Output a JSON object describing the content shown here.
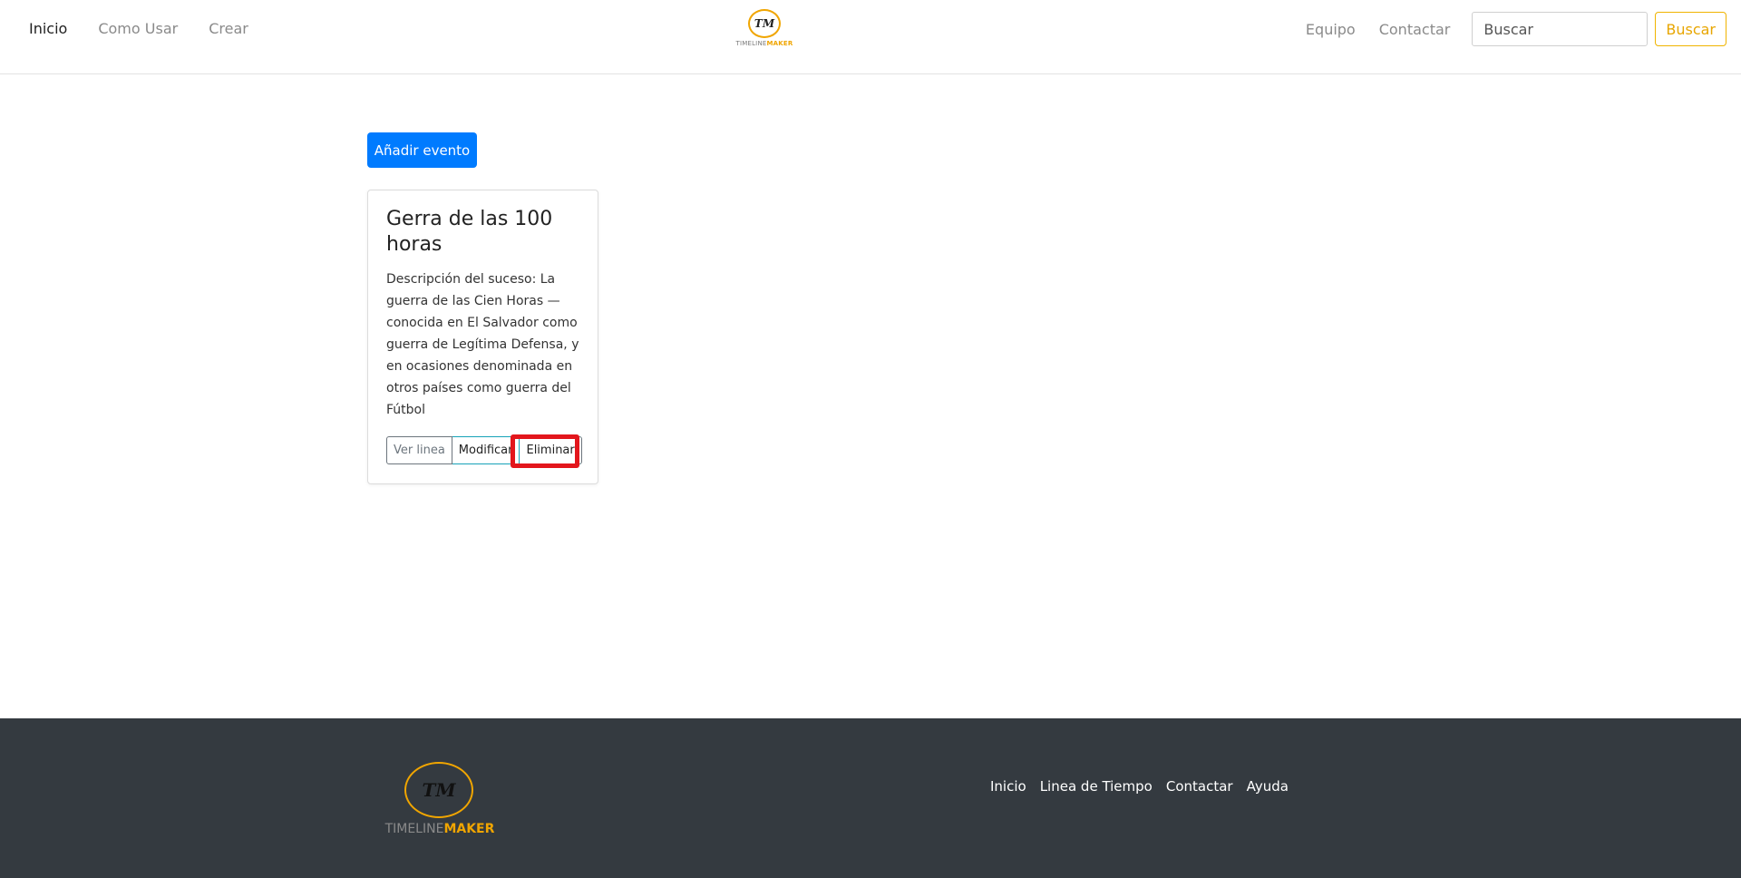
{
  "nav": {
    "left_links": [
      "Inicio",
      "Como Usar",
      "Crear"
    ],
    "right_links": [
      "Equipo",
      "Contactar"
    ],
    "search": {
      "placeholder": "Buscar",
      "button_label": "Buscar"
    },
    "logo": {
      "monogram": "TM",
      "word_a": "TIMELINE",
      "word_b": "MAKER"
    }
  },
  "main": {
    "add_event_label": "Añadir evento",
    "card": {
      "title": "Gerra de las 100 horas",
      "description": "Descripción del suceso: La guerra de las Cien Horas —conocida en El Salvador como guerra de Legítima Defensa, y en ocasiones denominada en otros países como guerra del Fútbol",
      "buttons": {
        "view": "Ver linea",
        "modify": "Modificar",
        "delete": "Eliminar"
      }
    }
  },
  "footer": {
    "logo": {
      "monogram": "TM",
      "word_a": "TIMELINE",
      "word_b": "MAKER"
    },
    "links": [
      "Inicio",
      "Linea de Tiempo",
      "Contactar",
      "Ayuda"
    ]
  },
  "colors": {
    "accent": "#f0a500",
    "primary": "#007bff",
    "footer_bg": "#343a40",
    "highlight": "#e3161c"
  }
}
